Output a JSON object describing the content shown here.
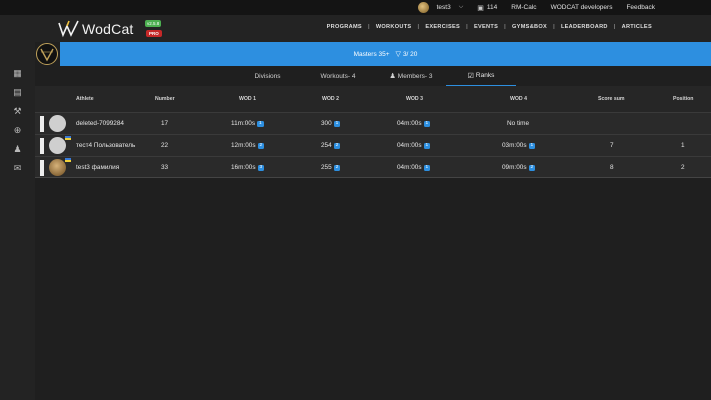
{
  "topbar": {
    "username": "test3",
    "coins": "114",
    "links": [
      "RM-Calc",
      "WODCAT developers",
      "Feedback"
    ]
  },
  "header": {
    "logo_text": "WodCat",
    "version_badge": "v2.5.8",
    "pro_badge": "PRO",
    "nav": [
      "PROGRAMS",
      "WORKOUTS",
      "EXERCISES",
      "EVENTS",
      "GYMS&BOX",
      "LEADERBOARD",
      "ARTICLES"
    ]
  },
  "banner": {
    "division": "Masters 35+",
    "count": "3/ 20"
  },
  "tabs": [
    {
      "label": "Divisions"
    },
    {
      "label": "Workouts- 4"
    },
    {
      "label": "Members- 3"
    },
    {
      "label": "Ranks"
    }
  ],
  "table": {
    "headers": [
      "Athlete",
      "Number",
      "WOD 1",
      "WOD 2",
      "WOD 3",
      "WOD 4",
      "Score sum",
      "Position"
    ],
    "rows": [
      {
        "athlete": "deleted-7099284",
        "number": "17",
        "wod1": "11m:00s",
        "wod1_rank": "1",
        "wod2": "300",
        "wod2_rank": "1",
        "wod3": "04m:00s",
        "wod3_rank": "1",
        "wod4": "No time",
        "wod4_rank": "",
        "score": "",
        "position": ""
      },
      {
        "athlete": "тест4 Пользователь",
        "number": "22",
        "wod1": "12m:00s",
        "wod1_rank": "2",
        "wod2": "254",
        "wod2_rank": "2",
        "wod3": "04m:00s",
        "wod3_rank": "1",
        "wod4": "03m:00s",
        "wod4_rank": "1",
        "score": "7",
        "position": "1"
      },
      {
        "athlete": "test3 фамилия",
        "number": "33",
        "wod1": "16m:00s",
        "wod1_rank": "3",
        "wod2": "255",
        "wod2_rank": "2",
        "wod3": "04m:00s",
        "wod3_rank": "1",
        "wod4": "09m:00s",
        "wod4_rank": "2",
        "score": "8",
        "position": "2"
      }
    ]
  },
  "colors": {
    "accent": "#2d8fe0",
    "pro": "#c62828",
    "version": "#4caf50"
  }
}
